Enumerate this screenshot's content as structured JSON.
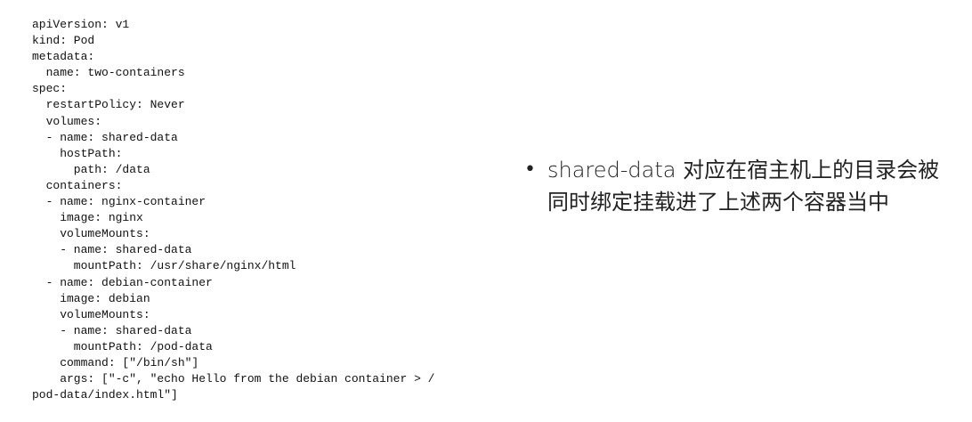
{
  "code": {
    "lines": [
      "apiVersion: v1",
      "kind: Pod",
      "metadata:",
      "  name: two-containers",
      "spec:",
      "  restartPolicy: Never",
      "  volumes:",
      "  - name: shared-data",
      "    hostPath:",
      "      path: /data",
      "  containers:",
      "  - name: nginx-container",
      "    image: nginx",
      "    volumeMounts:",
      "    - name: shared-data",
      "      mountPath: /usr/share/nginx/html",
      "  - name: debian-container",
      "    image: debian",
      "    volumeMounts:",
      "    - name: shared-data",
      "      mountPath: /pod-data",
      "    command: [\"/bin/sh\"]",
      "    args: [\"-c\", \"echo Hello from the debian container > /",
      "pod-data/index.html\"]"
    ]
  },
  "bullets": [
    {
      "marker": "•",
      "text": "shared-data 对应在宿主机上的目录会被同时绑定挂载进了上述两个容器当中"
    }
  ]
}
